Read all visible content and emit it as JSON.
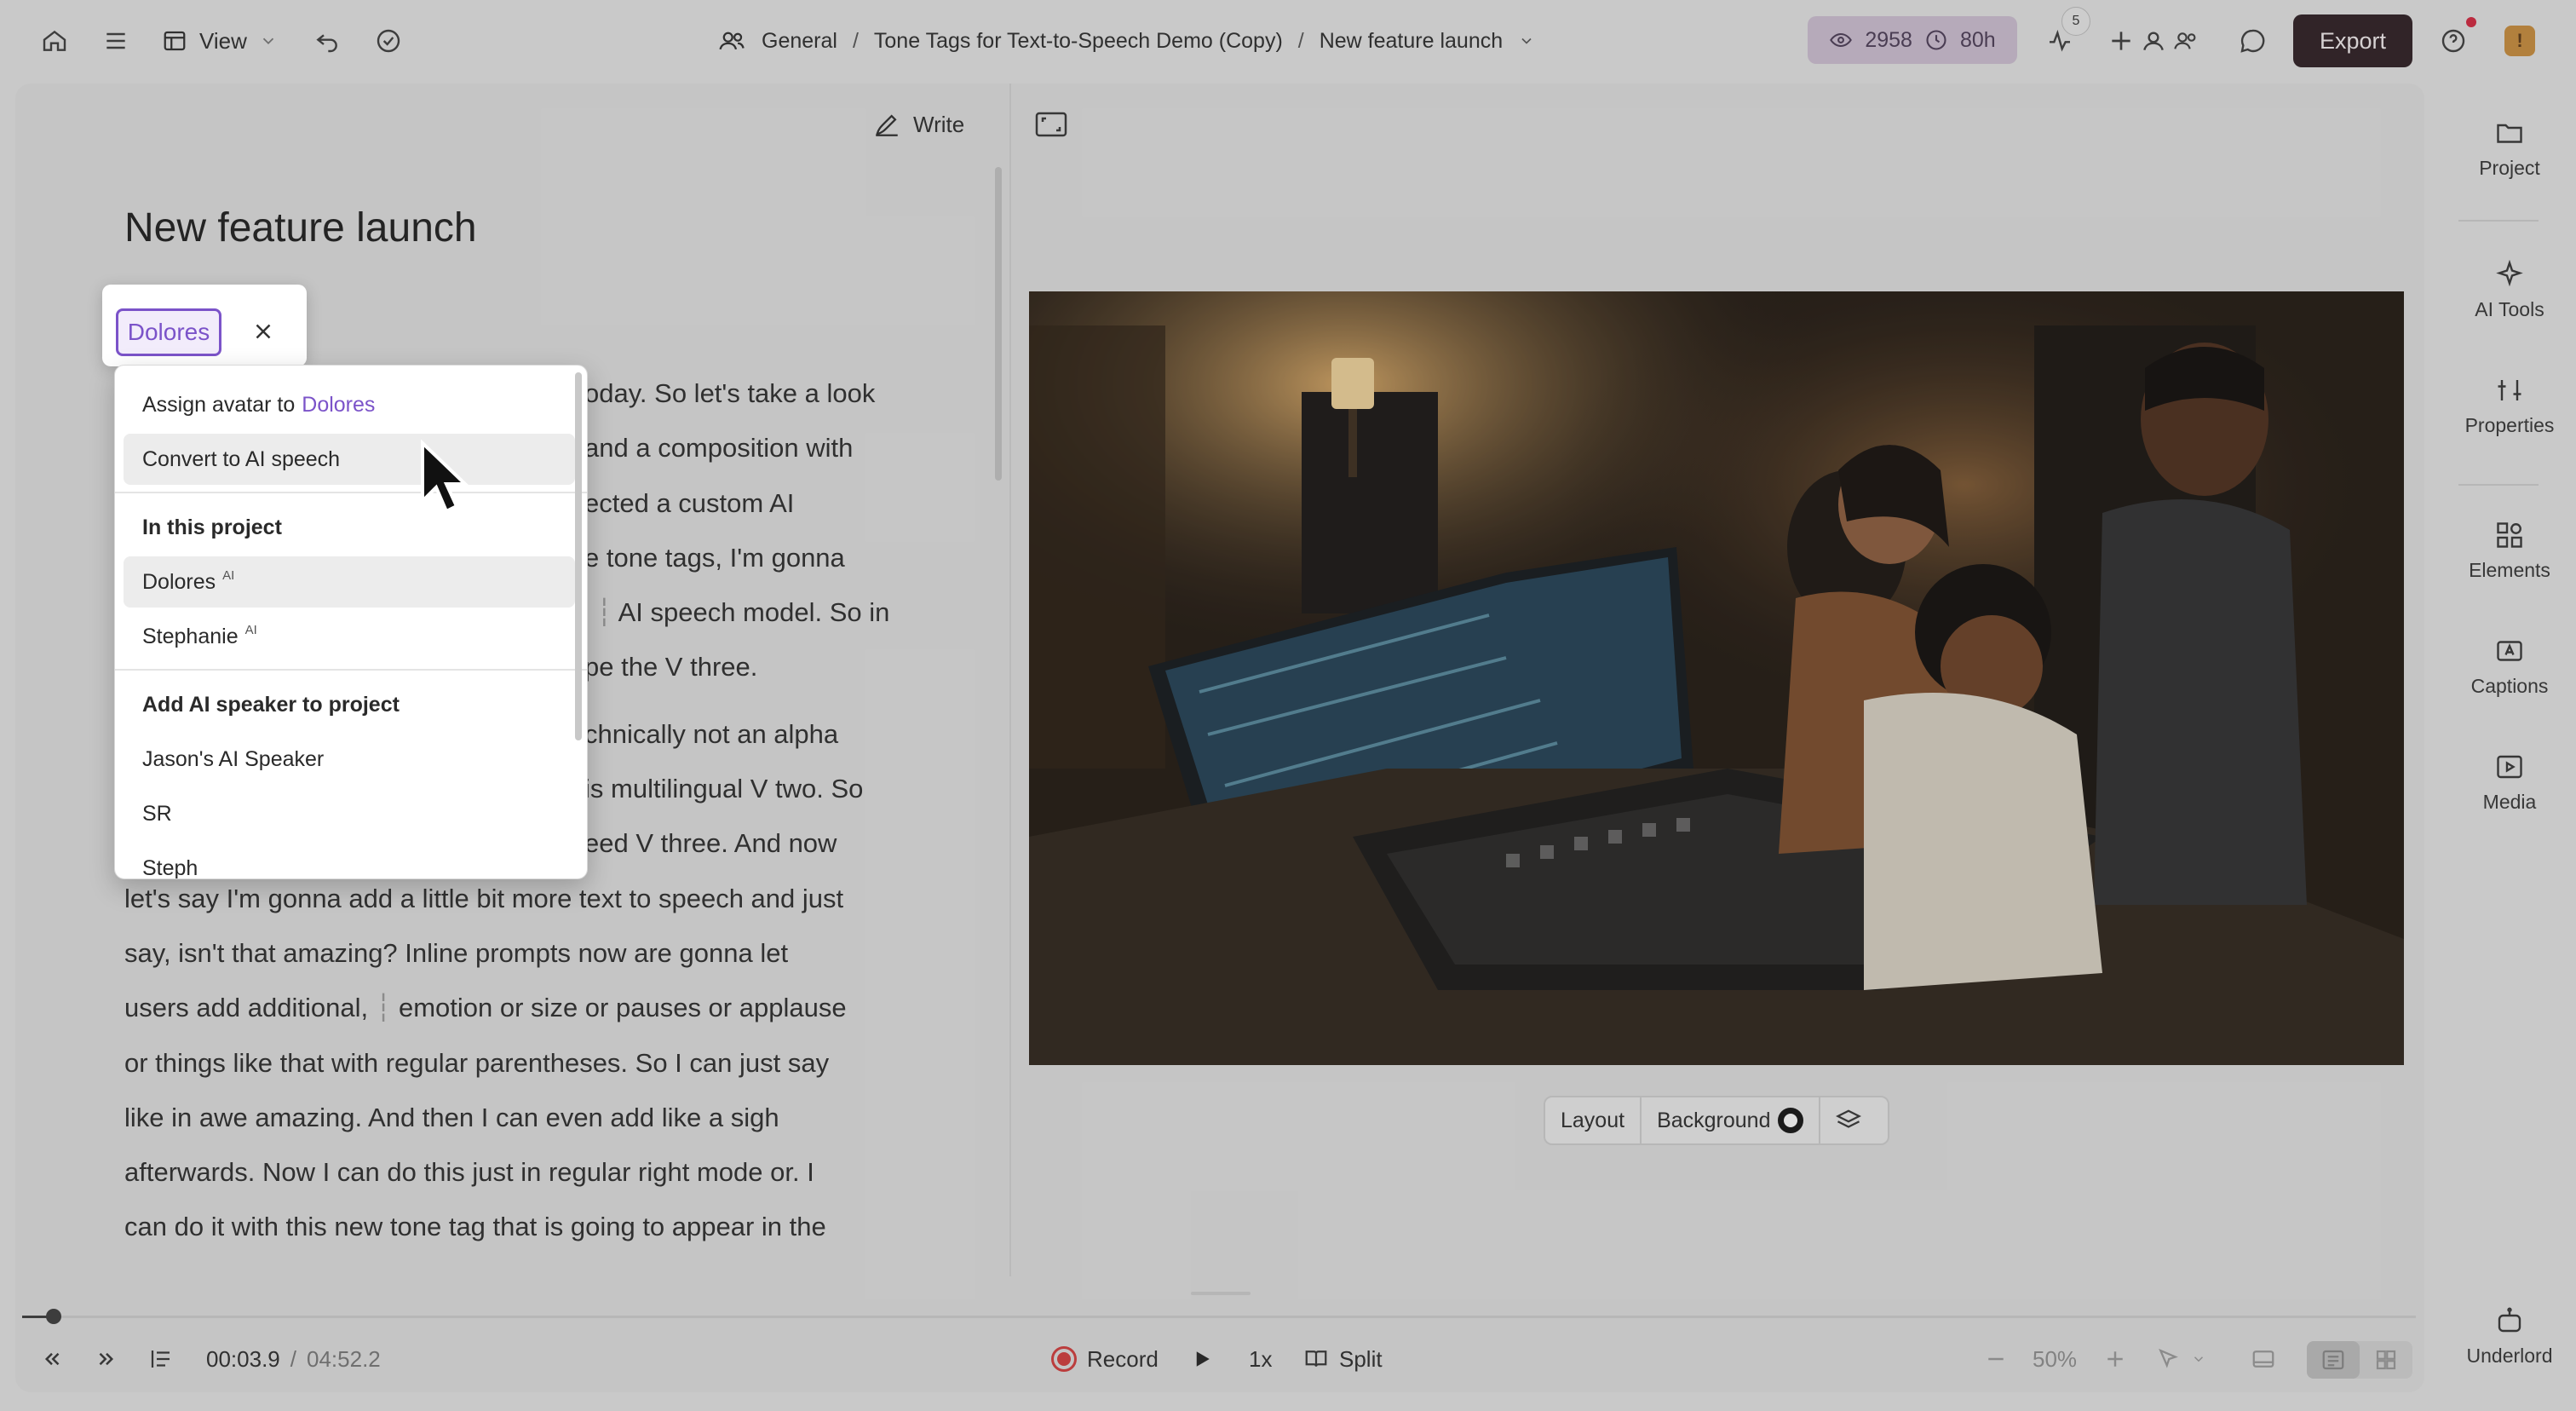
{
  "topbar": {
    "view_label": "View",
    "breadcrumb": {
      "workspace": "General",
      "project": "Tone Tags for Text-to-Speech Demo (Copy)",
      "composition": "New feature launch",
      "separator": "/"
    },
    "usage": {
      "credits": "2958",
      "hours": "80h"
    },
    "activity_badge": "5",
    "export_label": "Export",
    "accent_color": "#2b1c20"
  },
  "toolbar": {
    "write_label": "Write"
  },
  "document": {
    "title": "New feature launch",
    "paragraphs": [
      [
        "oday. So let's take a look",
        "and a composition with",
        "ected a custom AI",
        "e tone tags, I'm gonna",
        "AI speech model. So in",
        "pe the V three."
      ],
      [
        "chnically not an alpha",
        "is multilingual V two. So",
        "eed V three. And now",
        "let's say I'm gonna add a little bit more text to speech and just",
        "say, isn't that amazing? Inline prompts now are gonna let",
        "users add additional,",
        "emotion or size or pauses or applause",
        "or things like that with regular parentheses. So I can just say",
        "like in awe amazing. And then I can even add like a sigh",
        "afterwards. Now I can do this just in regular right mode or. I",
        "can do it with this new tone tag that is going to appear in the"
      ]
    ]
  },
  "speaker_popup": {
    "chip_label": "Dolores",
    "assign_prefix": "Assign avatar to",
    "assign_name": "Dolores",
    "convert_label": "Convert to AI speech",
    "in_project_heading": "In this project",
    "project_speakers": [
      {
        "name": "Dolores",
        "tag": "AI"
      },
      {
        "name": "Stephanie",
        "tag": "AI"
      }
    ],
    "add_heading": "Add AI speaker to project",
    "available_speakers": [
      "Jason's AI Speaker",
      "SR",
      "Steph"
    ],
    "accent_color": "#7b53c9"
  },
  "canvas": {
    "layout_label": "Layout",
    "background_label": "Background"
  },
  "right_rail": [
    "Project",
    "AI Tools",
    "Properties",
    "Elements",
    "Captions",
    "Media",
    "Underlord"
  ],
  "playback": {
    "current_time": "00:03",
    "current_frac": ".9",
    "total_time": "04:52",
    "total_frac": ".2",
    "time_sep": "/",
    "record_label": "Record",
    "speed": "1x",
    "split_label": "Split",
    "zoom": "50%",
    "progress": 0.013
  }
}
